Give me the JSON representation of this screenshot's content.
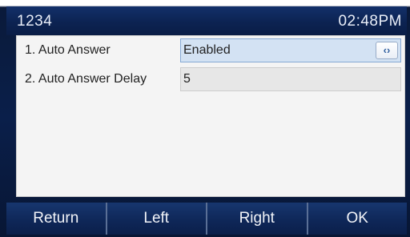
{
  "status_bar": {
    "account": "1234",
    "time": "02:48PM"
  },
  "settings": [
    {
      "label": "1. Auto Answer",
      "value": "Enabled",
      "toggle_icon": "left-right-arrows-icon"
    },
    {
      "label": "2. Auto Answer Delay",
      "value": "5"
    }
  ],
  "softkeys": {
    "return": "Return",
    "left": "Left",
    "right": "Right",
    "ok": "OK"
  },
  "colors": {
    "bar_background": "#0c2352",
    "panel_background": "#f4f4f4",
    "selected_field": "#d3e2f3",
    "field_background": "#e7e7e7"
  }
}
